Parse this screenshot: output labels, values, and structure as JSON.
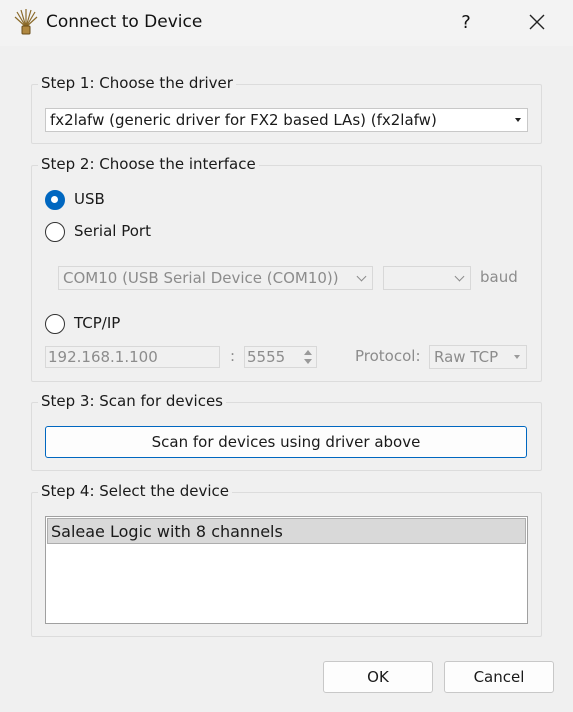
{
  "window": {
    "title": "Connect to Device",
    "help_label": "?",
    "app_icon": "sigrok-icon",
    "close_icon": "close-icon"
  },
  "step1": {
    "legend": "Step 1: Choose the driver",
    "driver_selected": "fx2lafw (generic driver for FX2 based LAs) (fx2lafw)"
  },
  "step2": {
    "legend": "Step 2: Choose the interface",
    "usb_label": "USB",
    "serial_label": "Serial Port",
    "serial_port_value": "COM10 (USB Serial Device (COM10))",
    "baud_value": "",
    "baud_label": "baud",
    "tcp_label": "TCP/IP",
    "host_value": "192.168.1.100",
    "port_separator": ":",
    "port_value": "5555",
    "protocol_label": "Protocol:",
    "protocol_value": "Raw TCP",
    "selected_interface": "USB"
  },
  "step3": {
    "legend": "Step 3: Scan for devices",
    "scan_button_label": "Scan for devices using driver above"
  },
  "step4": {
    "legend": "Step 4: Select the device",
    "devices": [
      "Saleae Logic with 8 channels"
    ],
    "selected_index": 0
  },
  "buttons": {
    "ok_label": "OK",
    "cancel_label": "Cancel"
  },
  "colors": {
    "accent": "#0067c0",
    "background": "#f0f0f0",
    "disabled_text": "#8c8c8c",
    "selection": "#d9d9d9"
  }
}
